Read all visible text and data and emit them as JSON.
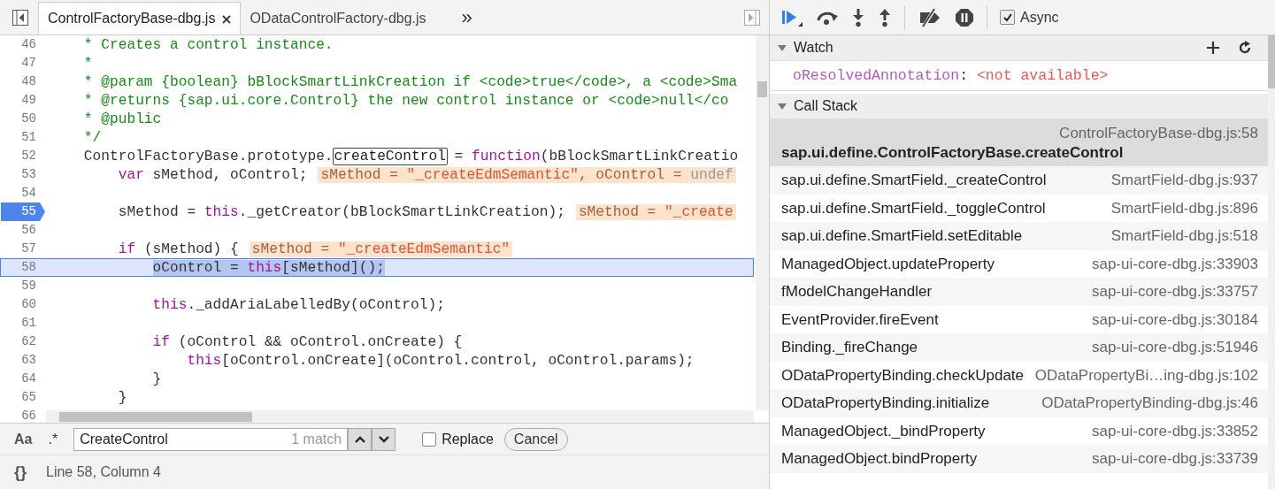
{
  "editor": {
    "tabs": [
      {
        "label": "ControlFactoryBase-dbg.js",
        "selected": true,
        "closable": true
      },
      {
        "label": "ODataControlFactory-dbg.js",
        "selected": false,
        "closable": false
      }
    ],
    "more_tabs": "»",
    "lines": [
      {
        "number": "46",
        "breakpoint": false,
        "current": false,
        "segments": [
          {
            "kind": "comment",
            "text": "    * Creates a control instance."
          }
        ]
      },
      {
        "number": "47",
        "breakpoint": false,
        "current": false,
        "segments": [
          {
            "kind": "comment",
            "text": "    *"
          }
        ]
      },
      {
        "number": "48",
        "breakpoint": false,
        "current": false,
        "segments": [
          {
            "kind": "comment",
            "text": "    * @param {boolean} bBlockSmartLinkCreation if <code>true</code>, a <code>Sma"
          }
        ]
      },
      {
        "number": "49",
        "breakpoint": false,
        "current": false,
        "segments": [
          {
            "kind": "comment",
            "text": "    * @returns {sap.ui.core.Control} the new control instance or <code>null</co"
          }
        ]
      },
      {
        "number": "50",
        "breakpoint": false,
        "current": false,
        "segments": [
          {
            "kind": "comment",
            "text": "    * @public"
          }
        ]
      },
      {
        "number": "51",
        "breakpoint": false,
        "current": false,
        "segments": [
          {
            "kind": "comment",
            "text": "    */"
          }
        ]
      },
      {
        "number": "52",
        "breakpoint": false,
        "current": false,
        "segments": [
          {
            "kind": "plain",
            "text": "    ControlFactoryBase.prototype."
          },
          {
            "kind": "match",
            "text": "createControl"
          },
          {
            "kind": "plain",
            "text": " = "
          },
          {
            "kind": "keyword",
            "text": "function"
          },
          {
            "kind": "plain",
            "text": "(bBlockSmartLinkCreatio"
          }
        ]
      },
      {
        "number": "53",
        "breakpoint": false,
        "current": false,
        "segments": [
          {
            "kind": "keyword",
            "text": "        var"
          },
          {
            "kind": "plain",
            "text": " sMethod, oControl;"
          }
        ],
        "inline_value": [
          {
            "kind": "name",
            "text": "sMethod = "
          },
          {
            "kind": "string",
            "text": "\"_createEdmSemantic\""
          },
          {
            "kind": "name",
            "text": ", oControl = "
          },
          {
            "kind": "undefined",
            "text": "undef"
          }
        ]
      },
      {
        "number": "54",
        "breakpoint": false,
        "current": false
      },
      {
        "number": "55",
        "breakpoint": true,
        "current": false,
        "segments": [
          {
            "kind": "plain",
            "text": "        sMethod = "
          },
          {
            "kind": "keyword",
            "text": "this"
          },
          {
            "kind": "plain",
            "text": "._getCreator(bBlockSmartLinkCreation);"
          }
        ],
        "inline_value": [
          {
            "kind": "name",
            "text": "sMethod = "
          },
          {
            "kind": "string",
            "text": "\"_create"
          }
        ]
      },
      {
        "number": "56",
        "breakpoint": false,
        "current": false
      },
      {
        "number": "57",
        "breakpoint": false,
        "current": false,
        "segments": [
          {
            "kind": "keyword",
            "text": "        if"
          },
          {
            "kind": "plain",
            "text": " (sMethod) {"
          }
        ],
        "inline_value": [
          {
            "kind": "name",
            "text": "sMethod = "
          },
          {
            "kind": "string",
            "text": "\"_createEdmSemantic\""
          }
        ]
      },
      {
        "number": "58",
        "breakpoint": false,
        "current": true,
        "segments": [
          {
            "kind": "selected",
            "text": "            oControl = "
          },
          {
            "kind": "selected-keyword",
            "text": "this"
          },
          {
            "kind": "selected",
            "text": "[sMethod]();"
          }
        ]
      },
      {
        "number": "59",
        "breakpoint": false,
        "current": false
      },
      {
        "number": "60",
        "breakpoint": false,
        "current": false,
        "segments": [
          {
            "kind": "keyword",
            "text": "            this"
          },
          {
            "kind": "plain",
            "text": "._addAriaLabelledBy(oControl);"
          }
        ]
      },
      {
        "number": "61",
        "breakpoint": false,
        "current": false
      },
      {
        "number": "62",
        "breakpoint": false,
        "current": false,
        "segments": [
          {
            "kind": "keyword",
            "text": "            if"
          },
          {
            "kind": "plain",
            "text": " (oControl && oControl.onCreate) {"
          }
        ]
      },
      {
        "number": "63",
        "breakpoint": false,
        "current": false,
        "segments": [
          {
            "kind": "keyword",
            "text": "                this"
          },
          {
            "kind": "plain",
            "text": "[oControl.onCreate](oControl.control, oControl.params);"
          }
        ]
      },
      {
        "number": "64",
        "breakpoint": false,
        "current": false,
        "segments": [
          {
            "kind": "plain",
            "text": "            }"
          }
        ]
      },
      {
        "number": "65",
        "breakpoint": false,
        "current": false,
        "segments": [
          {
            "kind": "plain",
            "text": "        }"
          }
        ]
      },
      {
        "number": "66",
        "breakpoint": false,
        "current": false
      }
    ],
    "search": {
      "case_button": "Aa",
      "regex_button": ".*",
      "value": "CreateControl",
      "match_count": "1 match",
      "replace_label": "Replace",
      "replace_checked": false,
      "cancel": "Cancel"
    },
    "status_bar": {
      "format_button": "{}",
      "position": "Line 58, Column 4"
    }
  },
  "debugger": {
    "async": {
      "label": "Async",
      "checked": true
    },
    "watch": {
      "title": "Watch",
      "expanded": true,
      "items": [
        {
          "name": "oResolvedAnnotation",
          "separator": ":",
          "value": "<not available>"
        }
      ]
    },
    "call_stack": {
      "title": "Call Stack",
      "expanded": true,
      "frames": [
        {
          "name": "sap.ui.define.ControlFactoryBase.createControl",
          "location": "ControlFactoryBase-dbg.js:58",
          "selected": true
        },
        {
          "name": "sap.ui.define.SmartField._createControl",
          "location": "SmartField-dbg.js:937",
          "selected": false
        },
        {
          "name": "sap.ui.define.SmartField._toggleControl",
          "location": "SmartField-dbg.js:896",
          "selected": false
        },
        {
          "name": "sap.ui.define.SmartField.setEditable",
          "location": "SmartField-dbg.js:518",
          "selected": false
        },
        {
          "name": "ManagedObject.updateProperty",
          "location": "sap-ui-core-dbg.js:33903",
          "selected": false
        },
        {
          "name": "fModelChangeHandler",
          "location": "sap-ui-core-dbg.js:33757",
          "selected": false
        },
        {
          "name": "EventProvider.fireEvent",
          "location": "sap-ui-core-dbg.js:30184",
          "selected": false
        },
        {
          "name": "Binding._fireChange",
          "location": "sap-ui-core-dbg.js:51946",
          "selected": false
        },
        {
          "name": "ODataPropertyBinding.checkUpdate",
          "location": "ODataPropertyBi…ing-dbg.js:102",
          "selected": false
        },
        {
          "name": "ODataPropertyBinding.initialize",
          "location": "ODataPropertyBinding-dbg.js:46",
          "selected": false
        },
        {
          "name": "ManagedObject._bindProperty",
          "location": "sap-ui-core-dbg.js:33852",
          "selected": false
        },
        {
          "name": "ManagedObject.bindProperty",
          "location": "sap-ui-core-dbg.js:33739",
          "selected": false
        }
      ]
    }
  }
}
